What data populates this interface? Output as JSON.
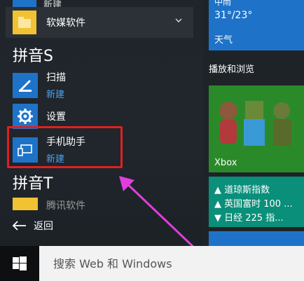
{
  "start_menu": {
    "top_partial_label": "新建",
    "folder": {
      "label": "软媒软件",
      "icon": "folder-icon"
    },
    "sections": [
      {
        "letter": "拼音S",
        "apps": [
          {
            "name": "扫描",
            "badge": "新建",
            "icon": "scanner-icon"
          },
          {
            "name": "设置",
            "badge": "",
            "icon": "gear-icon"
          },
          {
            "name": "手机助手",
            "badge": "新建",
            "icon": "phone-companion-icon"
          }
        ]
      },
      {
        "letter": "拼音T",
        "apps": [
          {
            "name": "腾讯软件",
            "badge": "",
            "icon": "folder-icon"
          }
        ]
      }
    ],
    "back_label": "返回"
  },
  "tiles": {
    "weather": {
      "condition": "中雨",
      "temperature": "31°/23°",
      "name": "天气"
    },
    "group_title": "播放和浏览",
    "xbox": {
      "label": "Xbox"
    },
    "money": {
      "lines": [
        "▲ 道琼斯指数",
        "▲ 英国富时 100 ...",
        "▼ 日经 225 指..."
      ]
    }
  },
  "taskbar": {
    "search_placeholder": "搜索 Web 和 Windows"
  },
  "colors": {
    "accent": "#1e73c8",
    "link": "#4aa3f0",
    "highlight": "#e02020",
    "arrow": "#e13ddc",
    "xbox_green": "#2a8a2a",
    "money_teal": "#0a8f7a"
  }
}
